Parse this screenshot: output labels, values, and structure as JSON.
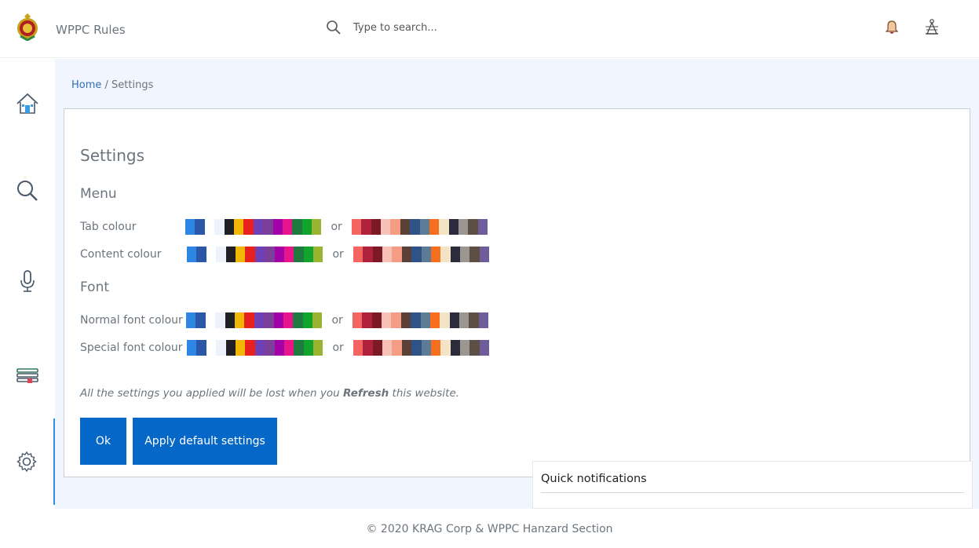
{
  "header": {
    "app_title": "WPPC Rules",
    "search_placeholder": "Type to search..."
  },
  "sidebar": {
    "items": [
      {
        "name": "home",
        "icon": "home-icon"
      },
      {
        "name": "search",
        "icon": "search-icon"
      },
      {
        "name": "voice",
        "icon": "microphone-icon"
      },
      {
        "name": "books",
        "icon": "books-icon"
      },
      {
        "name": "settings",
        "icon": "gear-icon",
        "active": true
      }
    ]
  },
  "breadcrumb": {
    "home": "Home",
    "separator": " / ",
    "current": "Settings"
  },
  "settings": {
    "title": "Settings",
    "menu_heading": "Menu",
    "font_heading": "Font",
    "rows": [
      {
        "label": "Tab colour"
      },
      {
        "label": "Content colour"
      },
      {
        "label": "Normal font colour"
      },
      {
        "label": "Special font colour"
      }
    ],
    "or_text": "or",
    "palette_a": [
      "#2e86e4",
      "#2a57a8",
      "#ffffff",
      "#eef2fb",
      "#1f1f24",
      "#f2b705",
      "#e8211f",
      "#6e3fb5",
      "#7b3f9a",
      "#a300a8",
      "#e7158c",
      "#1f7a3f",
      "#11a52d",
      "#9ab330"
    ],
    "palette_b": [
      "#f46561",
      "#b0213c",
      "#7b1a24",
      "#f7c2b5",
      "#f49c84",
      "#5a4036",
      "#2f5287",
      "#5d7b94",
      "#f86e1f",
      "#f4e4c6",
      "#2b2b3b",
      "#9b9692",
      "#5e4f45",
      "#6f5d9b"
    ],
    "note_prefix": "All the settings you applied will be lost when you ",
    "note_bold": "Refresh",
    "note_suffix": " this website.",
    "ok_label": "Ok",
    "default_label": "Apply default settings"
  },
  "quick_notifications": {
    "title": "Quick notifications"
  },
  "footer": {
    "text": "©  2020  KRAG Corp & WPPC Hanzard Section"
  },
  "colors": {
    "accent": "#0567c8",
    "link": "#2d6fb5",
    "main_bg": "#f1f5fd"
  }
}
